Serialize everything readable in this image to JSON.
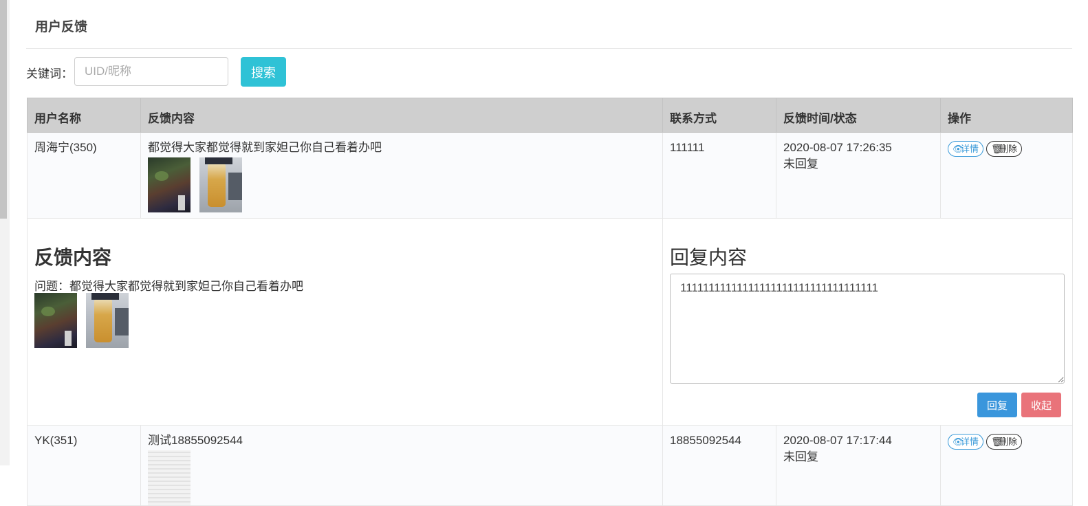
{
  "page": {
    "title": "用户反馈"
  },
  "search": {
    "label": "关键词：",
    "placeholder": "UID/昵称",
    "value": "",
    "button": "搜索"
  },
  "table": {
    "headers": [
      "用户名称",
      "反馈内容",
      "联系方式",
      "反馈时间/状态",
      "操作"
    ],
    "rows": [
      {
        "user": "周海宁(350)",
        "content": "都觉得大家都觉得就到家妲己你自己看着办吧",
        "contact": "111111",
        "time": "2020-08-07 17:26:35",
        "status": "未回复",
        "detail_btn": "详情",
        "delete_btn": "删除"
      },
      {
        "user": "YK(351)",
        "content": "测试18855092544",
        "contact": "18855092544",
        "time": "2020-08-07 17:17:44",
        "status": "未回复",
        "detail_btn": "详情",
        "delete_btn": "删除"
      }
    ]
  },
  "detail": {
    "feedback_title": "反馈内容",
    "question": "问题：都觉得大家都觉得就到家妲己你自己看着办吧",
    "reply_title": "回复内容",
    "reply_text": "11111111111111111111111111111111111",
    "reply_btn": "回复",
    "collapse_btn": "收起"
  },
  "colors": {
    "search_button": "#2fc2d6",
    "reply_button": "#3a96dc",
    "collapse_button": "#e9737a",
    "detail_link": "#3a9ad9"
  }
}
